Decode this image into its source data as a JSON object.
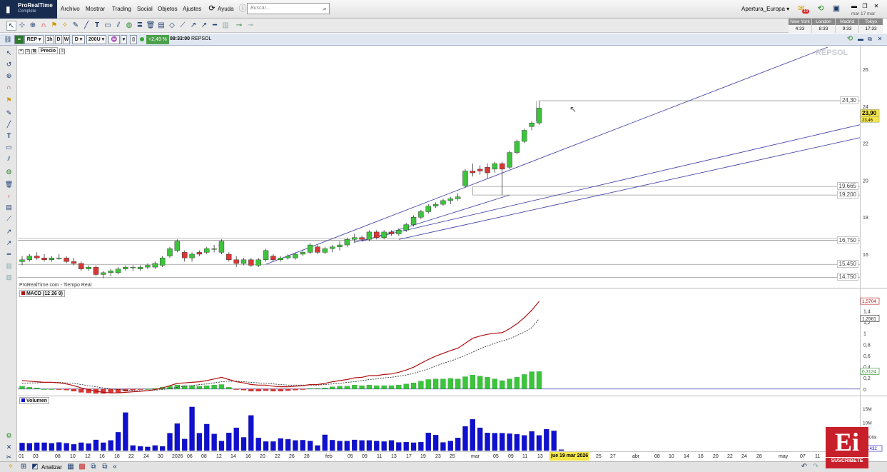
{
  "app": {
    "name": "ProRealTime",
    "edition": "Complete"
  },
  "menu": [
    "Archivo",
    "Mostrar",
    "Trading",
    "Social",
    "Objetos",
    "Ajustes",
    "Ayuda"
  ],
  "search": {
    "placeholder": "Buscar..."
  },
  "region": "Apertura_Europa",
  "notification_count": "19",
  "date_label": "mar 17 mar",
  "clocks": [
    {
      "city": "New York",
      "time": "4:33"
    },
    {
      "city": "London",
      "time": "8:33"
    },
    {
      "city": "Madrid",
      "time": "9:33"
    },
    {
      "city": "Tokyo",
      "time": "17:33"
    }
  ],
  "header": {
    "ticker": "REP",
    "intervals": [
      "1h",
      "D",
      "W"
    ],
    "interval_sel": "D",
    "units": "200U",
    "change": "+2,49 %",
    "time": "09:33:00",
    "name": "REPSOL"
  },
  "price_pane": {
    "title": "Precio",
    "watermark": "REPSOL",
    "last_price": "23,90",
    "last_price_small": "23,46",
    "levels": [
      "24,30",
      "19,665",
      "19,200",
      "16,750",
      "15,450",
      "14,750"
    ],
    "y_ticks": [
      "26",
      "24",
      "22",
      "20",
      "18",
      "16"
    ]
  },
  "source_label": "ProRealTime.com - Tiempo Real",
  "macd_pane": {
    "title": "MACD (12 26 9)",
    "val_macd": "1,5704",
    "val_signal": "1,2581",
    "val_hist": "0,3124",
    "y_ticks": [
      "1,4",
      "1,2",
      "1",
      "0,8",
      "0,6",
      "0,4",
      "0,2",
      "0"
    ]
  },
  "volume_pane": {
    "title": "Volumen",
    "y_ticks": [
      "15M",
      "10M",
      "5.000k"
    ],
    "last_val": "327.432"
  },
  "x_ticks": [
    "01",
    "03",
    "08",
    "10",
    "12",
    "16",
    "18",
    "22",
    "24",
    "30",
    "2026",
    "06",
    "08",
    "12",
    "14",
    "16",
    "20",
    "22",
    "26",
    "28",
    "feb",
    "05",
    "09",
    "11",
    "13",
    "17",
    "19",
    "23",
    "25",
    "mar",
    "05",
    "09",
    "11",
    "13",
    "25",
    "27",
    "abr",
    "08",
    "10",
    "14",
    "16",
    "20",
    "22",
    "24",
    "28",
    "may",
    "07",
    "11"
  ],
  "current_date": "jue 19 mar 2026",
  "bottom": {
    "analyze": "Analizar"
  },
  "subscribe": {
    "letter": "Ei",
    "text": "SUSCRÍBETE"
  },
  "colors": {
    "up": "#3cc43c",
    "down": "#d93636",
    "volume": "#1010d0",
    "macd": "#b01010",
    "trendline": "#4848a8",
    "header_bg": "#dfe6ef"
  },
  "chart_data": [
    {
      "type": "candlestick",
      "title": "Precio",
      "ylim": [
        14.3,
        27.2
      ],
      "candles": [
        {
          "o": 15.6,
          "h": 15.9,
          "l": 15.4,
          "c": 15.7
        },
        {
          "o": 15.7,
          "h": 16.0,
          "l": 15.6,
          "c": 15.9
        },
        {
          "o": 15.9,
          "h": 16.1,
          "l": 15.7,
          "c": 15.8
        },
        {
          "o": 15.8,
          "h": 16.0,
          "l": 15.6,
          "c": 15.7
        },
        {
          "o": 15.7,
          "h": 15.9,
          "l": 15.6,
          "c": 15.8
        },
        {
          "o": 15.8,
          "h": 16.0,
          "l": 15.7,
          "c": 15.8
        },
        {
          "o": 15.8,
          "h": 15.9,
          "l": 15.5,
          "c": 15.6
        },
        {
          "o": 15.6,
          "h": 15.8,
          "l": 15.4,
          "c": 15.5
        },
        {
          "o": 15.5,
          "h": 15.6,
          "l": 15.1,
          "c": 15.2
        },
        {
          "o": 15.2,
          "h": 15.4,
          "l": 15.1,
          "c": 15.3
        },
        {
          "o": 15.3,
          "h": 15.4,
          "l": 14.8,
          "c": 14.9
        },
        {
          "o": 14.9,
          "h": 15.1,
          "l": 14.7,
          "c": 15.0
        },
        {
          "o": 15.0,
          "h": 15.2,
          "l": 14.8,
          "c": 15.1
        },
        {
          "o": 15.0,
          "h": 15.3,
          "l": 14.9,
          "c": 15.2
        },
        {
          "o": 15.2,
          "h": 15.4,
          "l": 15.1,
          "c": 15.3
        },
        {
          "o": 15.3,
          "h": 15.4,
          "l": 15.1,
          "c": 15.3
        },
        {
          "o": 15.2,
          "h": 15.4,
          "l": 15.1,
          "c": 15.3
        },
        {
          "o": 15.3,
          "h": 15.5,
          "l": 15.2,
          "c": 15.4
        },
        {
          "o": 15.3,
          "h": 15.6,
          "l": 15.2,
          "c": 15.5
        },
        {
          "o": 15.4,
          "h": 15.9,
          "l": 15.3,
          "c": 15.8
        },
        {
          "o": 15.9,
          "h": 16.4,
          "l": 15.8,
          "c": 16.3
        },
        {
          "o": 16.2,
          "h": 16.8,
          "l": 16.1,
          "c": 16.7
        },
        {
          "o": 16.1,
          "h": 16.2,
          "l": 15.6,
          "c": 15.8
        },
        {
          "o": 15.8,
          "h": 16.1,
          "l": 15.6,
          "c": 16.0
        },
        {
          "o": 16.1,
          "h": 16.2,
          "l": 15.9,
          "c": 16.0
        },
        {
          "o": 16.1,
          "h": 16.4,
          "l": 16.0,
          "c": 16.3
        },
        {
          "o": 16.3,
          "h": 16.5,
          "l": 16.1,
          "c": 16.3
        },
        {
          "o": 16.1,
          "h": 16.8,
          "l": 16.0,
          "c": 16.7
        },
        {
          "o": 16.0,
          "h": 16.1,
          "l": 15.6,
          "c": 15.7
        },
        {
          "o": 15.7,
          "h": 15.9,
          "l": 15.3,
          "c": 15.5
        },
        {
          "o": 15.5,
          "h": 15.8,
          "l": 15.4,
          "c": 15.7
        },
        {
          "o": 15.7,
          "h": 15.8,
          "l": 15.3,
          "c": 15.4
        },
        {
          "o": 15.4,
          "h": 15.8,
          "l": 15.3,
          "c": 15.7
        },
        {
          "o": 15.7,
          "h": 16.3,
          "l": 15.6,
          "c": 16.2
        },
        {
          "o": 15.9,
          "h": 16.0,
          "l": 15.6,
          "c": 15.7
        },
        {
          "o": 15.7,
          "h": 15.9,
          "l": 15.6,
          "c": 15.8
        },
        {
          "o": 15.8,
          "h": 16.0,
          "l": 15.7,
          "c": 15.9
        },
        {
          "o": 15.8,
          "h": 16.1,
          "l": 15.7,
          "c": 16.0
        },
        {
          "o": 16.0,
          "h": 16.2,
          "l": 15.9,
          "c": 16.1
        },
        {
          "o": 16.1,
          "h": 16.6,
          "l": 16.0,
          "c": 16.5
        },
        {
          "o": 16.4,
          "h": 16.5,
          "l": 16.0,
          "c": 16.1
        },
        {
          "o": 16.1,
          "h": 16.4,
          "l": 16.0,
          "c": 16.3
        },
        {
          "o": 16.3,
          "h": 16.5,
          "l": 16.1,
          "c": 16.4
        },
        {
          "o": 16.4,
          "h": 16.7,
          "l": 16.2,
          "c": 16.5
        },
        {
          "o": 16.5,
          "h": 16.9,
          "l": 16.4,
          "c": 16.8
        },
        {
          "o": 16.8,
          "h": 17.1,
          "l": 16.6,
          "c": 16.9
        },
        {
          "o": 16.9,
          "h": 17.0,
          "l": 16.7,
          "c": 16.8
        },
        {
          "o": 16.8,
          "h": 17.3,
          "l": 16.7,
          "c": 17.2
        },
        {
          "o": 17.2,
          "h": 17.3,
          "l": 16.8,
          "c": 16.9
        },
        {
          "o": 16.9,
          "h": 17.3,
          "l": 16.8,
          "c": 17.2
        },
        {
          "o": 17.2,
          "h": 17.3,
          "l": 17.0,
          "c": 17.1
        },
        {
          "o": 17.1,
          "h": 17.4,
          "l": 17.0,
          "c": 17.3
        },
        {
          "o": 17.3,
          "h": 17.7,
          "l": 17.2,
          "c": 17.6
        },
        {
          "o": 17.6,
          "h": 18.1,
          "l": 17.5,
          "c": 18.0
        },
        {
          "o": 18.0,
          "h": 18.4,
          "l": 17.9,
          "c": 18.3
        },
        {
          "o": 18.3,
          "h": 18.7,
          "l": 18.2,
          "c": 18.6
        },
        {
          "o": 18.6,
          "h": 18.8,
          "l": 18.5,
          "c": 18.7
        },
        {
          "o": 18.7,
          "h": 19.0,
          "l": 18.6,
          "c": 18.9
        },
        {
          "o": 18.9,
          "h": 19.1,
          "l": 18.7,
          "c": 19.0
        },
        {
          "o": 19.0,
          "h": 19.3,
          "l": 18.9,
          "c": 19.1
        },
        {
          "o": 19.7,
          "h": 20.6,
          "l": 19.6,
          "c": 20.5
        },
        {
          "o": 20.5,
          "h": 20.9,
          "l": 20.2,
          "c": 20.4
        },
        {
          "o": 20.6,
          "h": 20.8,
          "l": 20.3,
          "c": 20.5
        },
        {
          "o": 20.7,
          "h": 20.9,
          "l": 20.1,
          "c": 20.4
        },
        {
          "o": 20.6,
          "h": 21.0,
          "l": 20.4,
          "c": 20.9
        },
        {
          "o": 20.9,
          "h": 21.0,
          "l": 19.2,
          "c": 20.6
        },
        {
          "o": 20.7,
          "h": 21.6,
          "l": 20.6,
          "c": 21.5
        },
        {
          "o": 21.5,
          "h": 22.2,
          "l": 21.4,
          "c": 22.1
        },
        {
          "o": 22.1,
          "h": 22.8,
          "l": 22.0,
          "c": 22.7
        },
        {
          "o": 22.9,
          "h": 23.2,
          "l": 22.7,
          "c": 23.1
        },
        {
          "o": 23.1,
          "h": 24.3,
          "l": 23.0,
          "c": 23.9
        }
      ]
    },
    {
      "type": "line",
      "title": "MACD (12 26 9)",
      "series": [
        {
          "name": "MACD",
          "values": [
            0.15,
            0.14,
            0.13,
            0.12,
            0.12,
            0.11,
            0.09,
            0.06,
            0.02,
            -0.01,
            -0.04,
            -0.06,
            -0.07,
            -0.07,
            -0.06,
            -0.05,
            -0.04,
            -0.03,
            -0.01,
            0.02,
            0.06,
            0.1,
            0.11,
            0.12,
            0.13,
            0.15,
            0.18,
            0.21,
            0.17,
            0.13,
            0.11,
            0.08,
            0.07,
            0.07,
            0.05,
            0.04,
            0.04,
            0.05,
            0.06,
            0.08,
            0.08,
            0.1,
            0.13,
            0.15,
            0.17,
            0.2,
            0.21,
            0.24,
            0.24,
            0.26,
            0.27,
            0.3,
            0.34,
            0.39,
            0.46,
            0.53,
            0.59,
            0.64,
            0.69,
            0.73,
            0.82,
            0.91,
            0.95,
            0.98,
            1.0,
            1.01,
            1.08,
            1.17,
            1.28,
            1.41,
            1.5704
          ]
        },
        {
          "name": "Signal",
          "values": [
            0.1,
            0.11,
            0.11,
            0.12,
            0.12,
            0.12,
            0.11,
            0.1,
            0.08,
            0.06,
            0.04,
            0.02,
            0.0,
            -0.01,
            -0.02,
            -0.03,
            -0.03,
            -0.03,
            -0.02,
            -0.01,
            0.01,
            0.03,
            0.05,
            0.06,
            0.08,
            0.09,
            0.11,
            0.13,
            0.14,
            0.14,
            0.13,
            0.12,
            0.11,
            0.1,
            0.09,
            0.08,
            0.07,
            0.07,
            0.07,
            0.07,
            0.07,
            0.08,
            0.09,
            0.1,
            0.12,
            0.13,
            0.15,
            0.17,
            0.18,
            0.2,
            0.21,
            0.23,
            0.25,
            0.28,
            0.32,
            0.36,
            0.41,
            0.46,
            0.5,
            0.55,
            0.6,
            0.66,
            0.72,
            0.77,
            0.82,
            0.86,
            0.9,
            0.96,
            1.02,
            1.1,
            1.2581
          ]
        },
        {
          "name": "Histogram",
          "values": [
            0.05,
            0.03,
            0.02,
            0.0,
            0.0,
            -0.01,
            -0.02,
            -0.04,
            -0.06,
            -0.07,
            -0.08,
            -0.08,
            -0.07,
            -0.06,
            -0.04,
            -0.02,
            -0.01,
            0.0,
            0.01,
            0.03,
            0.05,
            0.07,
            0.06,
            0.06,
            0.05,
            0.06,
            0.07,
            0.08,
            0.03,
            -0.01,
            -0.02,
            -0.04,
            -0.04,
            -0.03,
            -0.04,
            -0.04,
            -0.03,
            -0.02,
            -0.01,
            0.01,
            0.01,
            0.02,
            0.04,
            0.05,
            0.05,
            0.07,
            0.06,
            0.07,
            0.06,
            0.06,
            0.06,
            0.07,
            0.09,
            0.11,
            0.14,
            0.17,
            0.18,
            0.18,
            0.19,
            0.18,
            0.22,
            0.25,
            0.23,
            0.21,
            0.18,
            0.15,
            0.18,
            0.21,
            0.26,
            0.31,
            0.3124
          ]
        }
      ],
      "ylim": [
        -0.08,
        1.7
      ]
    },
    {
      "type": "bar",
      "title": "Volumen",
      "values": [
        2.7,
        2.6,
        2.8,
        2.8,
        2.6,
        2.9,
        2.6,
        2.2,
        2.8,
        2.5,
        3.8,
        2.8,
        3.6,
        6.5,
        13.5,
        1.8,
        1.5,
        1.3,
        1.8,
        1.5,
        6.2,
        9.6,
        4.1,
        15.5,
        6.2,
        9.4,
        5.9,
        3.4,
        6.3,
        8.1,
        4.7,
        12.5,
        4.5,
        3.2,
        3.2,
        4.3,
        4.0,
        3.6,
        3.7,
        3.4,
        1.8,
        5.6,
        3.7,
        3.4,
        3.4,
        3.8,
        3.6,
        3.6,
        3.4,
        3.2,
        3.6,
        2.9,
        3.0,
        2.8,
        3.0,
        6.3,
        5.5,
        2.9,
        3.4,
        4.5,
        8.6,
        11.1,
        8.1,
        6.3,
        6.2,
        6.2,
        6.0,
        5.8,
        5.4,
        6.8,
        5.4,
        7.6,
        7.0,
        0.33
      ],
      "ylim": [
        0,
        16.5
      ]
    }
  ]
}
